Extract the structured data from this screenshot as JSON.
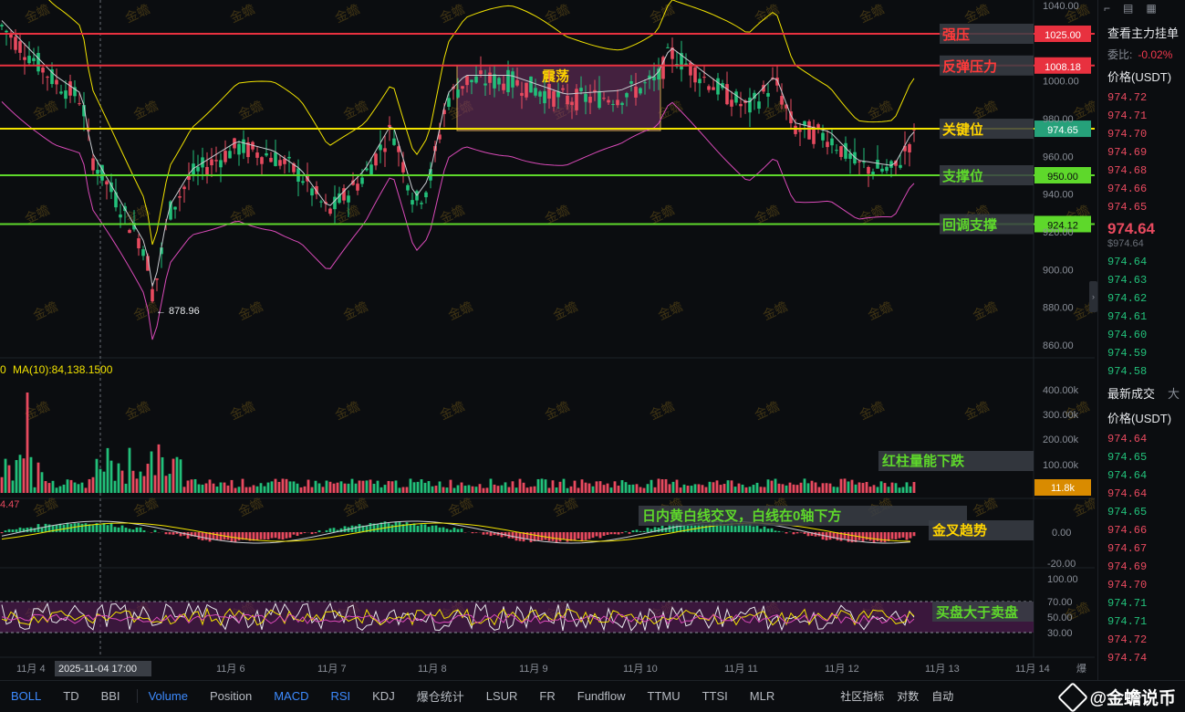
{
  "price_axis": {
    "ticks": [
      "1040.00",
      "1000.00",
      "980.00",
      "960.00",
      "940.00",
      "920.00",
      "900.00",
      "880.00",
      "860.00"
    ],
    "tick_values": [
      1040,
      1000,
      980,
      960,
      940,
      920,
      900,
      880,
      860
    ]
  },
  "levels": [
    {
      "label": "强压",
      "value": 1025.0,
      "value_text": "1025.00",
      "color": "#e8313f",
      "label_color": "#ff3a3a"
    },
    {
      "label": "反弹压力",
      "value": 1008.18,
      "value_text": "1008.18",
      "color": "#e8313f",
      "label_color": "#ff3a3a"
    },
    {
      "label": "关键位",
      "value": 974.65,
      "value_text": "974.65",
      "color": "#f2e300",
      "label_color": "#ffd400"
    },
    {
      "label": "支撑位",
      "value": 950.0,
      "value_text": "950.00",
      "color": "#5ed82b",
      "label_color": "#5ed82b"
    },
    {
      "label": "回调支撑",
      "value": 924.12,
      "value_text": "924.12",
      "color": "#5ed82b",
      "label_color": "#5ed82b"
    }
  ],
  "current_price_text": "974.65",
  "range_box_label": "震荡",
  "low_marker": "← 878.96",
  "volume": {
    "ma_label": "MA(10):84,138.1500",
    "left_cut": "0",
    "ticks": [
      "400.00k",
      "300.00k",
      "200.00k",
      "100.00k"
    ],
    "current": "11.8k",
    "annotation": "红柱量能下跌"
  },
  "macd": {
    "left_value": "4.47",
    "ticks": [
      "0.00",
      "-20.00"
    ],
    "annotation1": "日内黄白线交叉，白线在0轴下方",
    "annotation2": "金叉趋势"
  },
  "rsi": {
    "ticks": [
      "100.00",
      "70.00",
      "50.00",
      "30.00"
    ],
    "annotation": "买盘大于卖盘"
  },
  "time_axis": {
    "labels": [
      "11月 4",
      "11月 6",
      "11月 7",
      "11月 8",
      "11月 9",
      "11月 10",
      "11月 11",
      "11月 12",
      "11月 13",
      "11月 14"
    ],
    "crosshair_label": "2025-11-04 17:00",
    "right_cut": "爆"
  },
  "watermark": "金蟾",
  "right_panel": {
    "title": "查看主力挂单",
    "ratio_label": "委比:",
    "ratio_value": "-0.02%",
    "price_header": "价格(USDT)",
    "asks": [
      "974.72",
      "974.71",
      "974.70",
      "974.69",
      "974.68",
      "974.66",
      "974.65"
    ],
    "last_price": "974.64",
    "last_price_usd": "$974.64",
    "bids": [
      "974.64",
      "974.63",
      "974.62",
      "974.61",
      "974.60",
      "974.59",
      "974.58"
    ],
    "trades_header": "最新成交",
    "trades_header_cut": "大",
    "trades_price_header": "价格(USDT)",
    "trades": [
      {
        "p": "974.64",
        "side": "ask"
      },
      {
        "p": "974.65",
        "side": "bid"
      },
      {
        "p": "974.64",
        "side": "bid"
      },
      {
        "p": "974.64",
        "side": "ask"
      },
      {
        "p": "974.65",
        "side": "bid"
      },
      {
        "p": "974.66",
        "side": "ask"
      },
      {
        "p": "974.67",
        "side": "ask"
      },
      {
        "p": "974.69",
        "side": "ask"
      },
      {
        "p": "974.70",
        "side": "ask"
      },
      {
        "p": "974.71",
        "side": "bid"
      },
      {
        "p": "974.71",
        "side": "bid"
      },
      {
        "p": "974.72",
        "side": "ask"
      },
      {
        "p": "974.74",
        "side": "ask"
      }
    ]
  },
  "bottom_tabs": [
    {
      "label": "BOLL",
      "active": true
    },
    {
      "label": "TD",
      "active": false
    },
    {
      "label": "BBI",
      "active": false
    },
    {
      "label": "Volume",
      "active": true,
      "sep": true
    },
    {
      "label": "Position",
      "active": false
    },
    {
      "label": "MACD",
      "active": true
    },
    {
      "label": "RSI",
      "active": true
    },
    {
      "label": "KDJ",
      "active": false
    },
    {
      "label": "爆仓统计",
      "active": false
    },
    {
      "label": "LSUR",
      "active": false
    },
    {
      "label": "FR",
      "active": false
    },
    {
      "label": "Fundflow",
      "active": false
    },
    {
      "label": "TTMU",
      "active": false
    },
    {
      "label": "TTSI",
      "active": false
    },
    {
      "label": "MLR",
      "active": false
    }
  ],
  "bottom_extra": [
    "社区指标",
    "对数",
    "自动"
  ],
  "brand": "@金蟾说币"
}
